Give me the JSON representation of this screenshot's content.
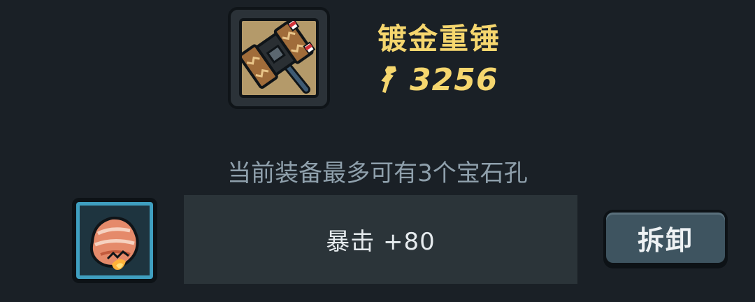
{
  "equipment": {
    "name": "镀金重锤",
    "icon": "gilded-hammer-icon",
    "power_icon": "power-fist-icon",
    "power_value": "3256"
  },
  "gem_socket": {
    "info_text": "当前装备最多可有3个宝石孔",
    "gem_icon": "fire-gem-icon",
    "stat_text": "暴击 +80",
    "remove_label": "拆卸"
  },
  "colors": {
    "background": "#1a2026",
    "name_gold": "#f5d66e",
    "info_text": "#8fa0ac",
    "socket_border": "#3f9fc0",
    "stat_panel": "#2b3439",
    "button_face": "#3e5460"
  }
}
